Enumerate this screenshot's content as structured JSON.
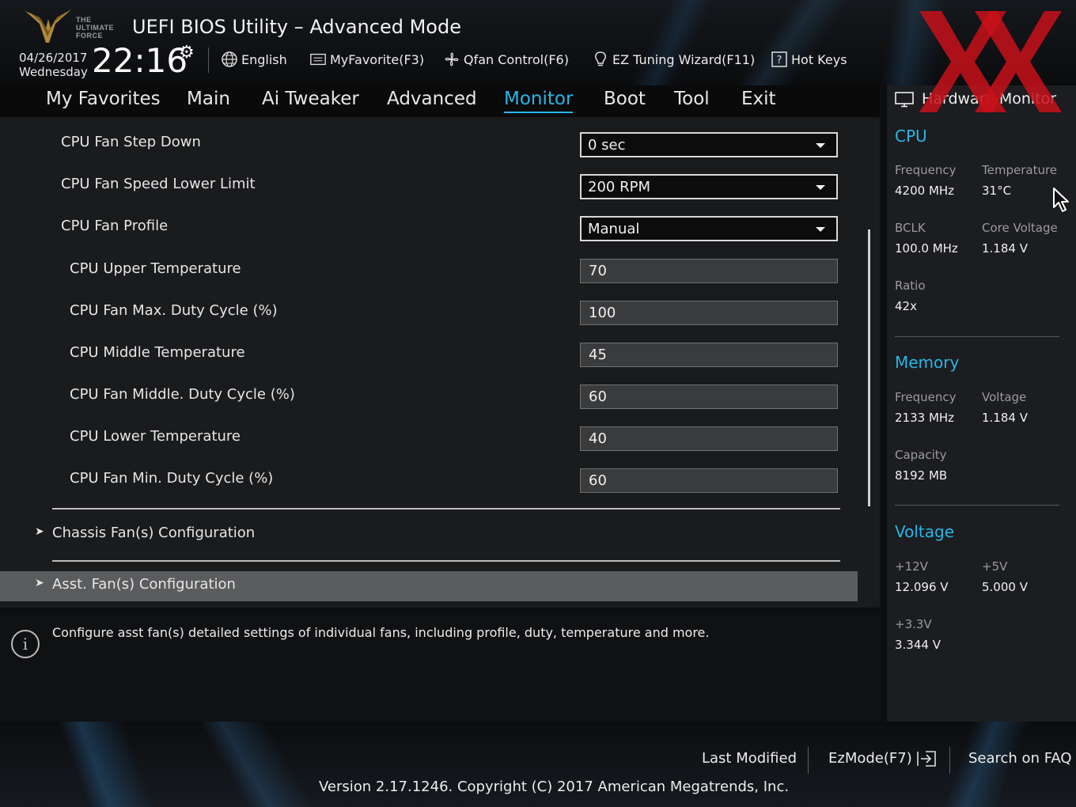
{
  "header": {
    "logo_text": [
      "THE",
      "ULTIMATE",
      "FORCE"
    ],
    "title": "UEFI BIOS Utility – Advanced Mode",
    "date": "04/26/2017",
    "weekday": "Wednesday",
    "time": "22:16",
    "toolbar": {
      "language": "English",
      "my_favorite": "MyFavorite(F3)",
      "qfan": "Qfan Control(F6)",
      "ez_tuning": "EZ Tuning Wizard(F11)",
      "hot_keys": "Hot Keys"
    }
  },
  "tabs": [
    "My Favorites",
    "Main",
    "Ai Tweaker",
    "Advanced",
    "Monitor",
    "Boot",
    "Tool",
    "Exit"
  ],
  "active_tab": "Monitor",
  "settings": {
    "cpu_fan_step_down": {
      "label": "CPU Fan Step Down",
      "value": "0 sec"
    },
    "cpu_fan_speed_lower_limit": {
      "label": "CPU Fan Speed Lower Limit",
      "value": "200 RPM"
    },
    "cpu_fan_profile": {
      "label": "CPU Fan Profile",
      "value": "Manual"
    },
    "cpu_upper_temperature": {
      "label": "CPU Upper Temperature",
      "value": "70"
    },
    "cpu_fan_max_duty": {
      "label": "CPU Fan Max. Duty Cycle (%)",
      "value": "100"
    },
    "cpu_middle_temperature": {
      "label": "CPU Middle Temperature",
      "value": "45"
    },
    "cpu_fan_middle_duty": {
      "label": "CPU Fan Middle. Duty Cycle (%)",
      "value": "60"
    },
    "cpu_lower_temperature": {
      "label": "CPU Lower Temperature",
      "value": "40"
    },
    "cpu_fan_min_duty": {
      "label": "CPU Fan Min. Duty Cycle (%)",
      "value": "60"
    }
  },
  "submenus": {
    "chassis": "Chassis Fan(s) Configuration",
    "asst": "Asst. Fan(s) Configuration"
  },
  "help_text": "Configure asst fan(s) detailed settings of individual fans, including profile, duty, temperature and more.",
  "hardware_monitor": {
    "title": "Hardware Monitor",
    "cpu": {
      "heading": "CPU",
      "frequency_label": "Frequency",
      "frequency": "4200 MHz",
      "temperature_label": "Temperature",
      "temperature": "31°C",
      "bclk_label": "BCLK",
      "bclk": "100.0 MHz",
      "core_voltage_label": "Core Voltage",
      "core_voltage": "1.184 V",
      "ratio_label": "Ratio",
      "ratio": "42x"
    },
    "memory": {
      "heading": "Memory",
      "frequency_label": "Frequency",
      "frequency": "2133 MHz",
      "voltage_label": "Voltage",
      "voltage": "1.184 V",
      "capacity_label": "Capacity",
      "capacity": "8192 MB"
    },
    "voltage": {
      "heading": "Voltage",
      "v12_label": "+12V",
      "v12": "12.096 V",
      "v5_label": "+5V",
      "v5": "5.000 V",
      "v33_label": "+3.3V",
      "v33": "3.344 V"
    }
  },
  "footer": {
    "last_modified": "Last Modified",
    "ezmode": "EzMode(F7)",
    "search_faq": "Search on FAQ",
    "version": "Version 2.17.1246. Copyright (C) 2017 American Megatrends, Inc."
  },
  "colors": {
    "accent": "#29b6e6",
    "selected_row": "#5b5c5e",
    "watermark": "#c8101a"
  }
}
